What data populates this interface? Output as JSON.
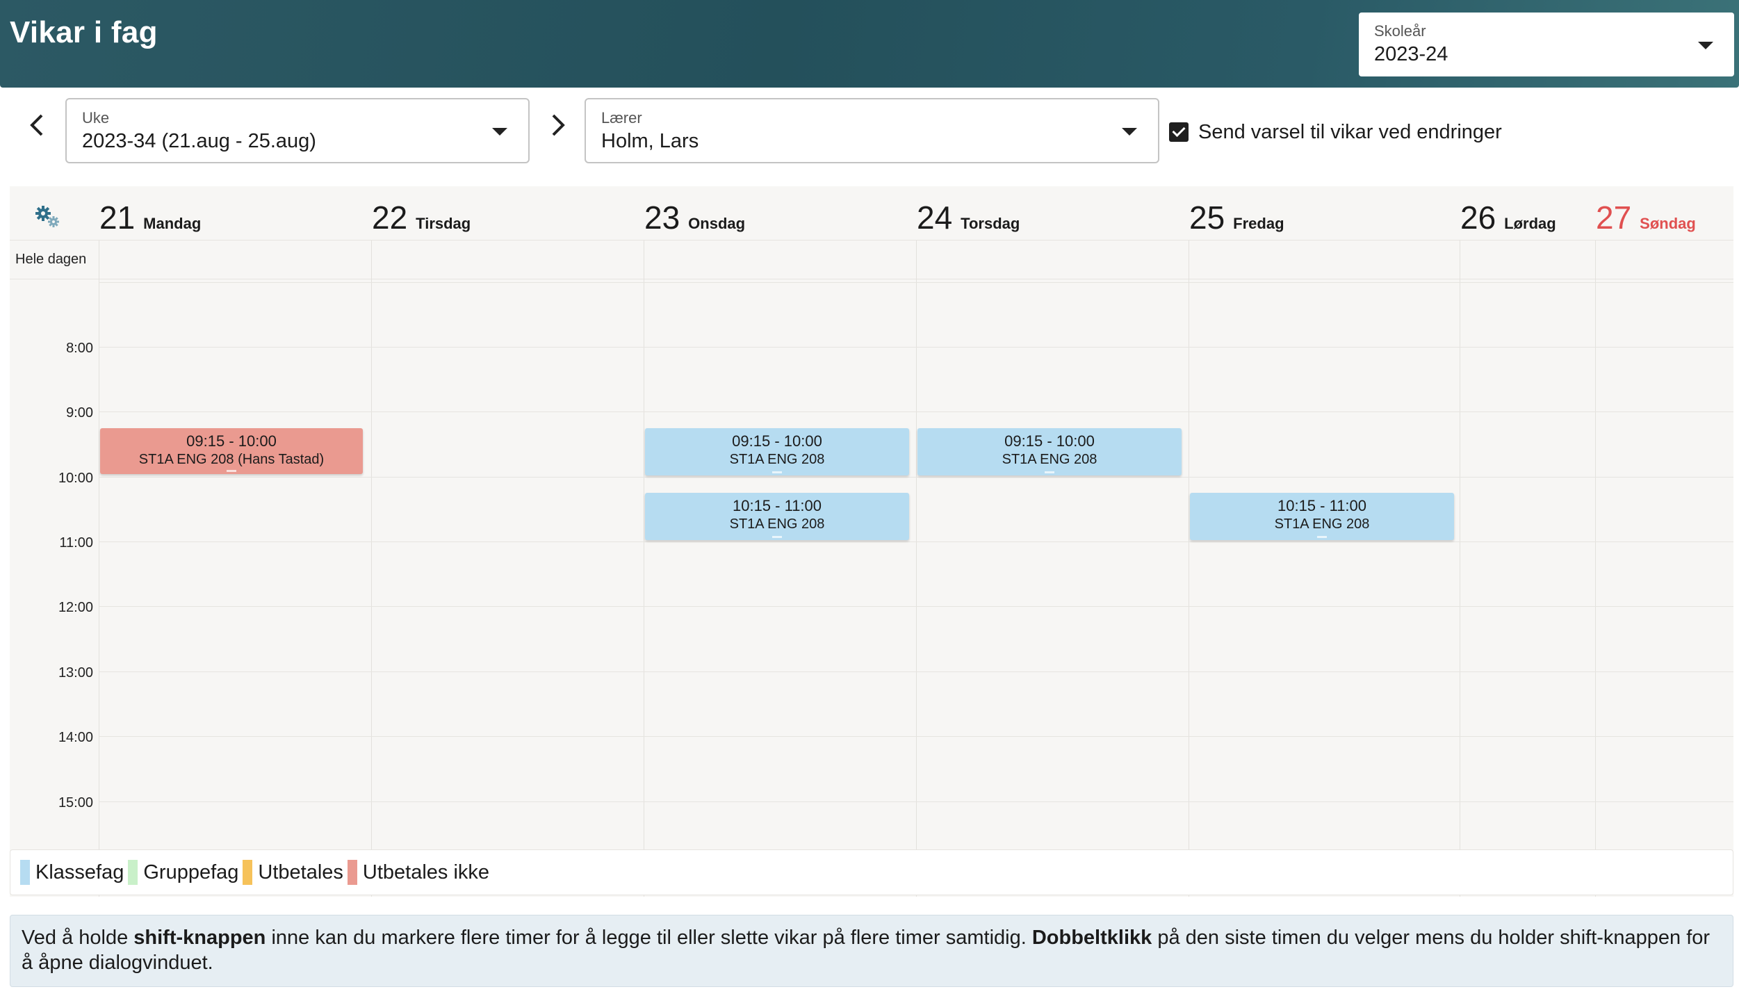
{
  "header": {
    "title": "Vikar i fag",
    "school_year": {
      "label": "Skoleår",
      "value": "2023-24"
    }
  },
  "toolbar": {
    "week": {
      "label": "Uke",
      "value": "2023-34 (21.aug - 25.aug)"
    },
    "teacher": {
      "label": "Lærer",
      "value": "Holm, Lars"
    },
    "notify_label": "Send varsel til vikar ved endringer",
    "notify_checked": true
  },
  "calendar": {
    "allday_label": "Hele dagen",
    "days": [
      {
        "num": "21",
        "name": "Mandag"
      },
      {
        "num": "22",
        "name": "Tirsdag"
      },
      {
        "num": "23",
        "name": "Onsdag"
      },
      {
        "num": "24",
        "name": "Torsdag"
      },
      {
        "num": "25",
        "name": "Fredag"
      },
      {
        "num": "26",
        "name": "Lørdag"
      },
      {
        "num": "27",
        "name": "Søndag"
      }
    ],
    "times": [
      "8:00",
      "9:00",
      "10:00",
      "11:00",
      "12:00",
      "13:00",
      "14:00",
      "15:00"
    ],
    "events": [
      {
        "time": "09:15 - 10:00",
        "title": "ST1A ENG 208 (Hans Tastad)"
      },
      {
        "time": "09:15 - 10:00",
        "title": "ST1A ENG 208"
      },
      {
        "time": "10:15 - 11:00",
        "title": "ST1A ENG 208"
      },
      {
        "time": "09:15 - 10:00",
        "title": "ST1A ENG 208"
      },
      {
        "time": "10:15 - 11:00",
        "title": "ST1A ENG 208"
      }
    ]
  },
  "legend": [
    {
      "label": "Klassefag",
      "color": "#b6dcf1"
    },
    {
      "label": "Gruppefag",
      "color": "#c9f0c9"
    },
    {
      "label": "Utbetales",
      "color": "#f6c25a"
    },
    {
      "label": "Utbetales ikke",
      "color": "#ea9a90"
    }
  ],
  "info": {
    "part1": "Ved å holde ",
    "bold1": "shift-knappen",
    "part2": " inne kan du markere flere timer for å legge til eller slette vikar på flere timer samtidig. ",
    "bold2": "Dobbeltklikk",
    "part3": " på den siste timen du velger mens du holder shift-knappen for å åpne dialogvinduet."
  },
  "colors": {
    "header_bg": "#2a5661",
    "event_class": "#b6dcf1",
    "event_unpaid": "#ea9a90",
    "sunday": "#e05050",
    "info_bg": "#e6eef3"
  }
}
